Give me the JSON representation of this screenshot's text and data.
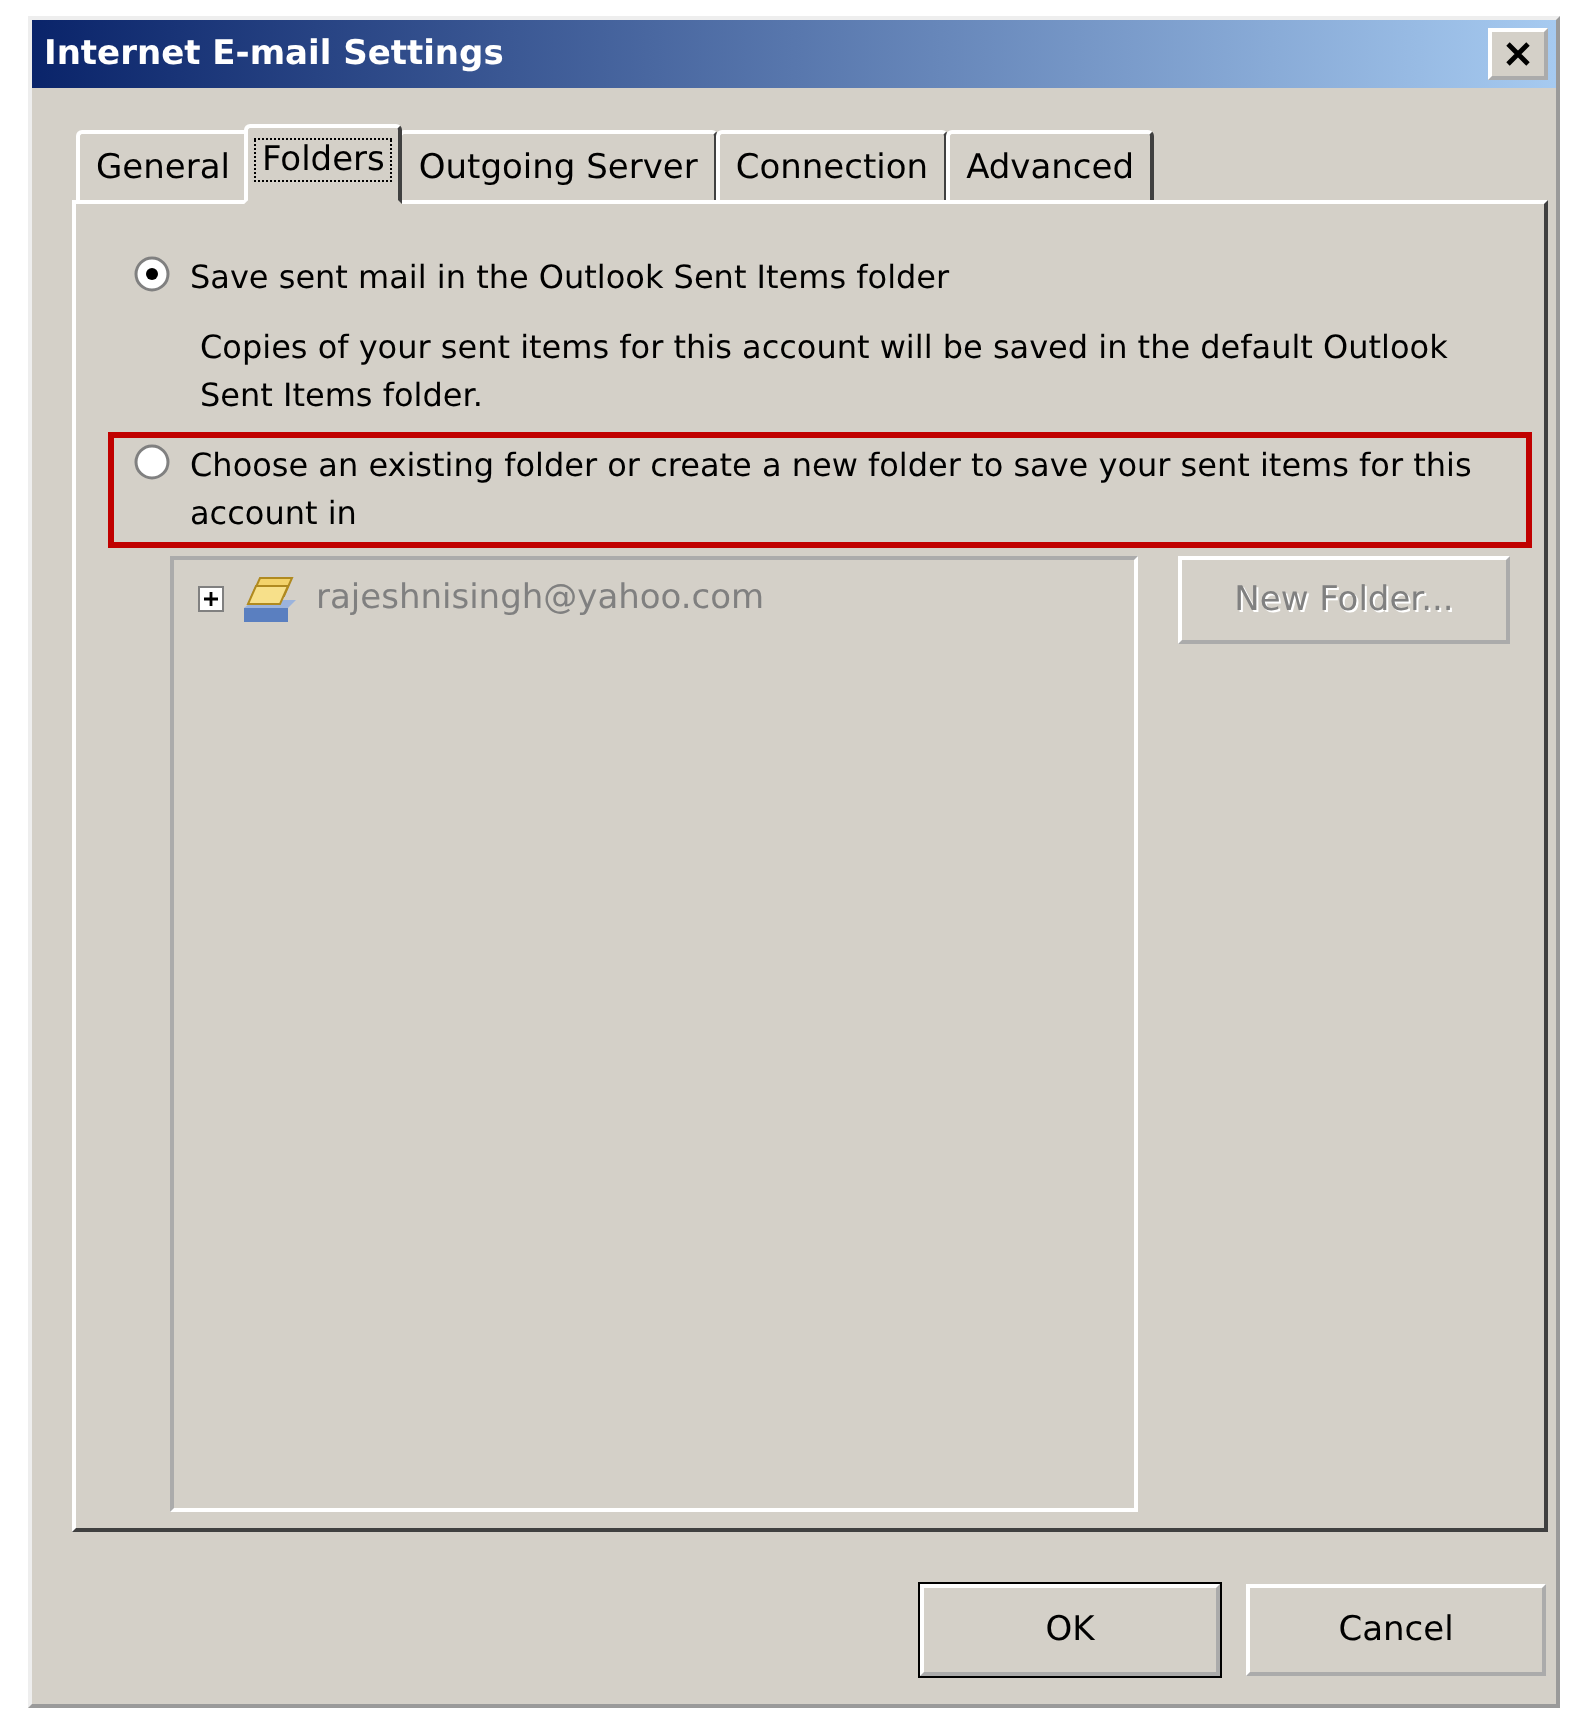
{
  "window": {
    "title": "Internet E-mail Settings"
  },
  "tabs": [
    {
      "label": "General",
      "selected": false
    },
    {
      "label": "Folders",
      "selected": true
    },
    {
      "label": "Outgoing Server",
      "selected": false
    },
    {
      "label": "Connection",
      "selected": false
    },
    {
      "label": "Advanced",
      "selected": false
    }
  ],
  "options": [
    {
      "label": "Save sent mail in the Outlook Sent Items folder",
      "selected": true,
      "highlighted": false,
      "description": "Copies of your sent items for this account will be saved in the default Outlook Sent Items folder."
    },
    {
      "label": "Choose an existing folder or create a new folder to save your sent items for this account in",
      "selected": false,
      "highlighted": true
    }
  ],
  "folder_tree": {
    "disabled": true,
    "items": [
      {
        "label": "rajeshnisingh@yahoo.com",
        "expanded": false
      }
    ]
  },
  "new_folder_button": {
    "label": "New Folder...",
    "disabled": true
  },
  "buttons": [
    {
      "label": "OK",
      "default": true
    },
    {
      "label": "Cancel",
      "default": false
    }
  ]
}
